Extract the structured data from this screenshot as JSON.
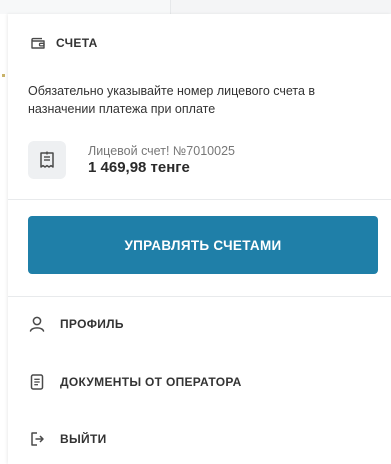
{
  "accounts": {
    "title": "СЧЕТА",
    "note": "Обязательно указывайте номер лицевого счета в назначении платежа при оплате",
    "account_number": "Лицевой счет! №7010025",
    "balance": "1 469,98 тенге",
    "manage_button": "УПРАВЛЯТЬ СЧЕТАМИ"
  },
  "menu": {
    "profile": "ПРОФИЛЬ",
    "documents": "ДОКУМЕНТЫ ОТ ОПЕРАТОРА",
    "logout": "ВЫЙТИ"
  },
  "colors": {
    "accent": "#1f7fa8",
    "icon": "#4a4a4a",
    "icon_bg": "#eef0f2"
  },
  "icons": {
    "section": "wallet-icon",
    "account": "receipt-icon",
    "profile": "user-icon",
    "documents": "document-icon",
    "logout": "logout-icon"
  }
}
